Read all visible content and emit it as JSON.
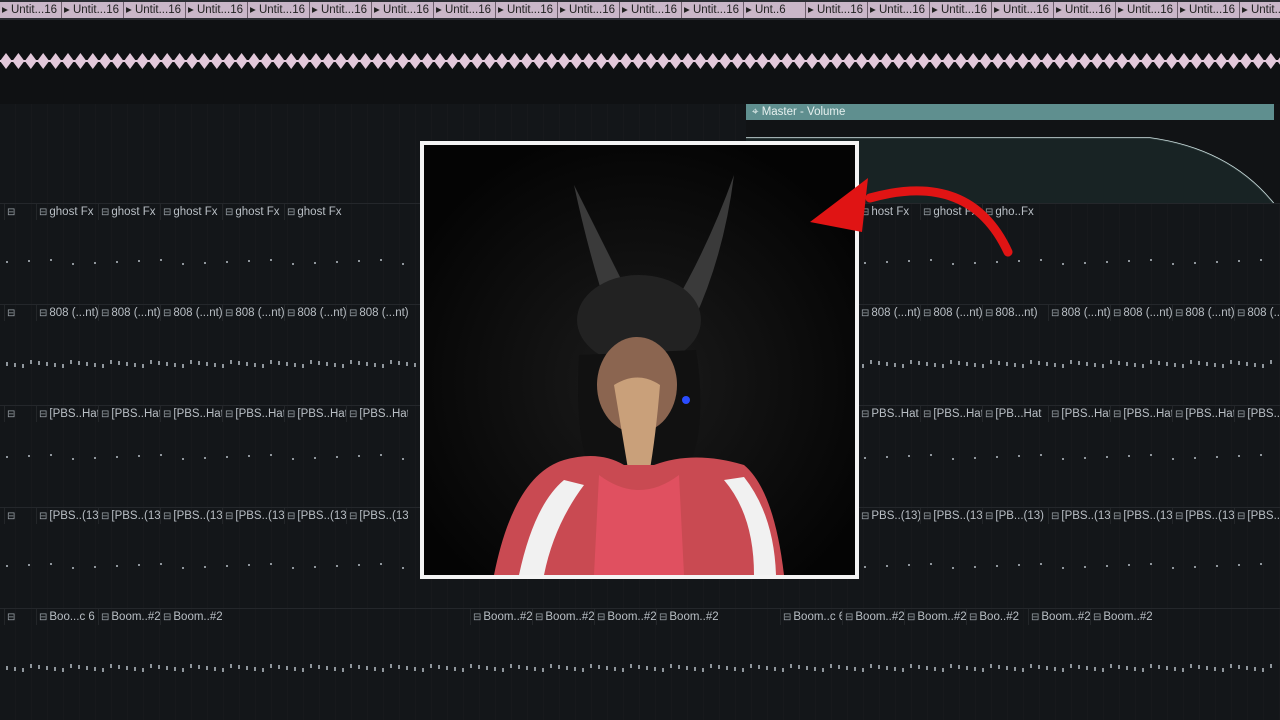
{
  "top_clips": [
    "Untit...16",
    "Untit...16",
    "Untit...16",
    "Untit...16",
    "Untit...16",
    "Untit...16",
    "Untit...16",
    "Untit...16",
    "Untit...16",
    "Untit...16",
    "Untit...16",
    "Untit...16",
    "Unt..6",
    "Untit...16",
    "Untit...16",
    "Untit...16",
    "Untit...16",
    "Untit...16",
    "Untit...16",
    "Untit...16",
    "Untit...16"
  ],
  "automation_label": "Master - Volume",
  "tracks": [
    {
      "key": "ghost",
      "left": [
        "ghost Fx",
        "ghost Fx",
        "ghost Fx",
        "ghost Fx",
        "ghost Fx"
      ],
      "right": [
        "host Fx",
        "ghost Fx",
        "gho..Fx"
      ]
    },
    {
      "key": "808",
      "left": [
        "808 (...nt)",
        "808 (...nt)",
        "808 (...nt)",
        "808 (...nt)",
        "808 (...nt)",
        "808 (...nt)"
      ],
      "right": [
        "808 (...nt)",
        "808 (...nt)",
        "808...nt)",
        "808 (...nt)",
        "808 (...nt)",
        "808 (...nt)",
        "808 (...nt)"
      ]
    },
    {
      "key": "hat",
      "left": [
        "[PBS..Hat",
        "[PBS..Hat",
        "[PBS..Hat",
        "[PBS..Hat",
        "[PBS..Hat",
        "[PBS..Hat"
      ],
      "right": [
        "PBS..Hat",
        "[PBS..Hat",
        "[PB...Hat",
        "[PBS..Hat",
        "[PBS..Hat",
        "[PBS..Hat",
        "[PBS..Hat"
      ]
    },
    {
      "key": "pbs13",
      "left": [
        "[PBS..(13)",
        "[PBS..(13)",
        "[PBS..(13)",
        "[PBS..(13)",
        "[PBS..(13)",
        "[PBS..(13)"
      ],
      "right": [
        "PBS..(13)",
        "[PBS..(13)",
        "[PB...(13)",
        "[PBS..(13)",
        "[PBS..(13)",
        "[PBS..(13)",
        "[PBS..(13)"
      ]
    },
    {
      "key": "boom",
      "left": [
        "Boo...c 6",
        "Boom..#2",
        "Boom..#2"
      ],
      "mid": [
        "Boom..#2",
        "Boom..#2",
        "Boom..#2",
        "Boom..#2"
      ],
      "right": [
        "Boom..c 6",
        "Boom..#2",
        "Boom..#2",
        "Boo..#2",
        "Boom..#2",
        "Boom..#2"
      ]
    }
  ],
  "colors": {
    "arrow": "#e01414",
    "frame": "#f4f4f4",
    "waveform": "#e2c8da",
    "automation": "#5f8f8f"
  },
  "icons": {
    "clip_glyph": "pattern-icon",
    "arrow": "red-curved-arrow-icon"
  }
}
